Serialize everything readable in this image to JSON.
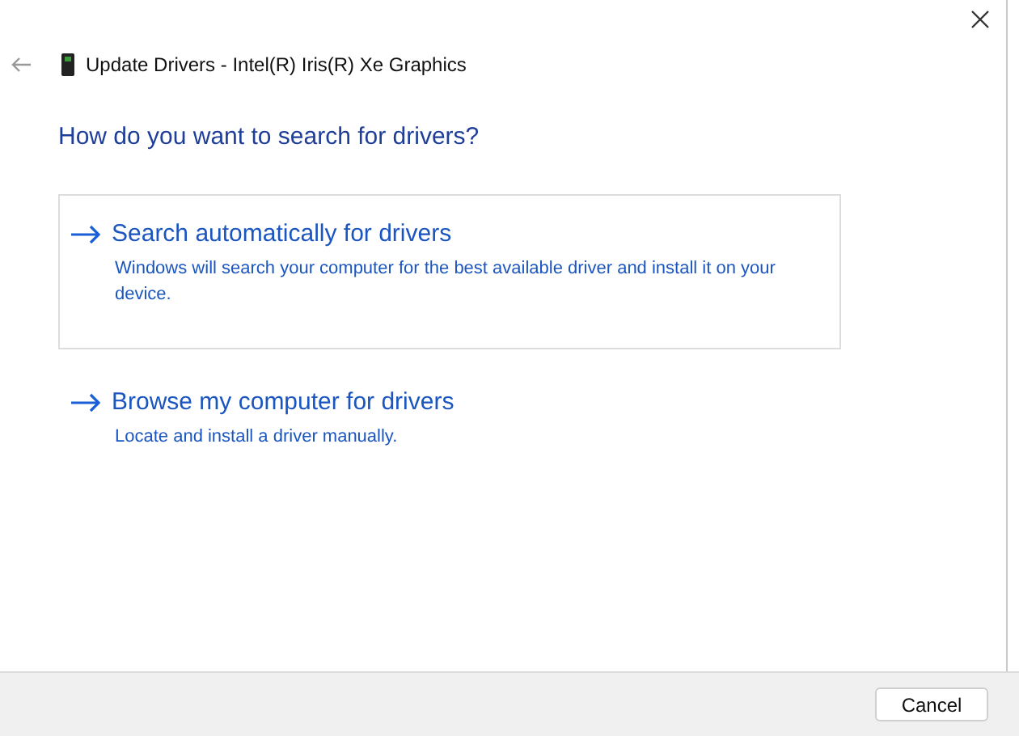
{
  "window": {
    "title": "Update Drivers - Intel(R) Iris(R) Xe Graphics"
  },
  "heading": "How do you want to search for drivers?",
  "options": [
    {
      "title": "Search automatically for drivers",
      "description": "Windows will search your computer for the best available driver and install it on your device.",
      "selected": true
    },
    {
      "title": "Browse my computer for drivers",
      "description": "Locate and install a driver manually.",
      "selected": false
    }
  ],
  "buttons": [
    "Cancel"
  ]
}
